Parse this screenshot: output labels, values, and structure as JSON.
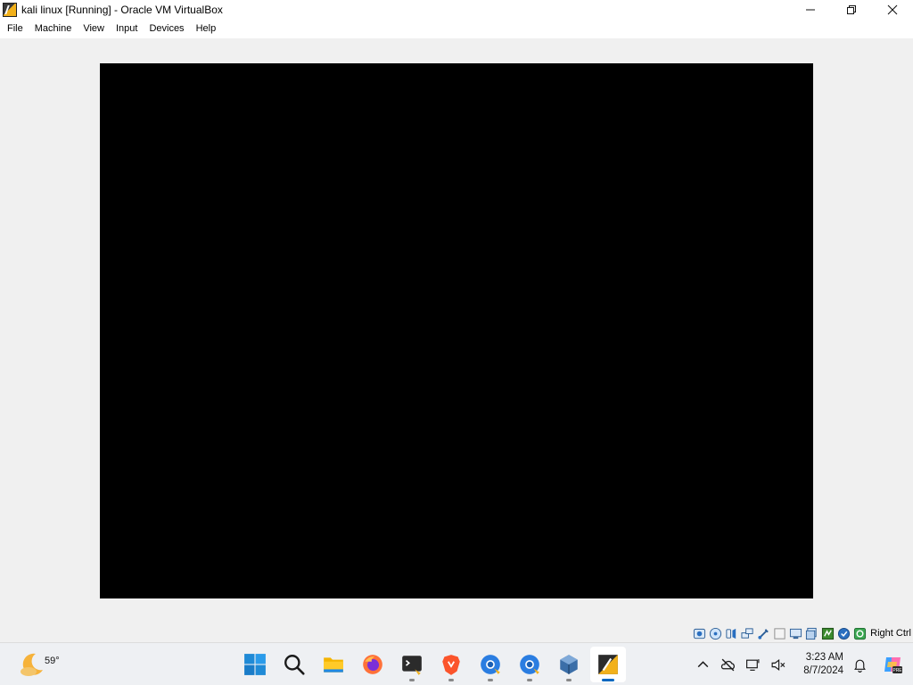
{
  "window": {
    "title": "kali linux [Running] - Oracle VM VirtualBox",
    "app_icon": "kali-virtualbox-icon",
    "controls": [
      "minimize-icon",
      "maximize-icon",
      "close-icon"
    ]
  },
  "menu": {
    "items": [
      {
        "label": "File"
      },
      {
        "label": "Machine"
      },
      {
        "label": "View"
      },
      {
        "label": "Input"
      },
      {
        "label": "Devices"
      },
      {
        "label": "Help"
      }
    ]
  },
  "vm": {
    "screen_color": "#000000"
  },
  "statusbar": {
    "icons": [
      "hard-disk-icon",
      "optical-drive-icon",
      "audio-icon",
      "network-icon",
      "usb-icon",
      "shared-folders-icon",
      "display-icon",
      "recording-icon",
      "cpu-icon",
      "mouse-integration-icon",
      "keyboard-icon"
    ],
    "host_key": "Right Ctrl"
  },
  "taskbar": {
    "weather": {
      "temp": "59°",
      "icon": "moon-cloud-icon"
    },
    "apps": [
      {
        "name": "start-button",
        "icon": "windows-logo-icon",
        "running": false
      },
      {
        "name": "search-button",
        "icon": "search-icon",
        "running": false
      },
      {
        "name": "file-explorer",
        "icon": "folder-icon",
        "running": false
      },
      {
        "name": "firefox",
        "icon": "firefox-icon",
        "running": false
      },
      {
        "name": "terminal",
        "icon": "terminal-icon",
        "running": true
      },
      {
        "name": "brave",
        "icon": "brave-icon",
        "running": true
      },
      {
        "name": "chrome-profile-1",
        "icon": "chrome-icon",
        "running": true
      },
      {
        "name": "chrome-profile-2",
        "icon": "chrome-icon",
        "running": true
      },
      {
        "name": "virtualbox",
        "icon": "virtualbox-icon",
        "running": true
      },
      {
        "name": "kali-vm",
        "icon": "kali-vm-icon",
        "running": true,
        "active": true
      }
    ],
    "tray": {
      "icons": [
        "chevron-up-icon",
        "onedrive-offline-icon",
        "network-icon",
        "volume-muted-icon",
        "bell-icon",
        "copilot-icon"
      ],
      "time": "3:23 AM",
      "date": "8/7/2024"
    }
  }
}
